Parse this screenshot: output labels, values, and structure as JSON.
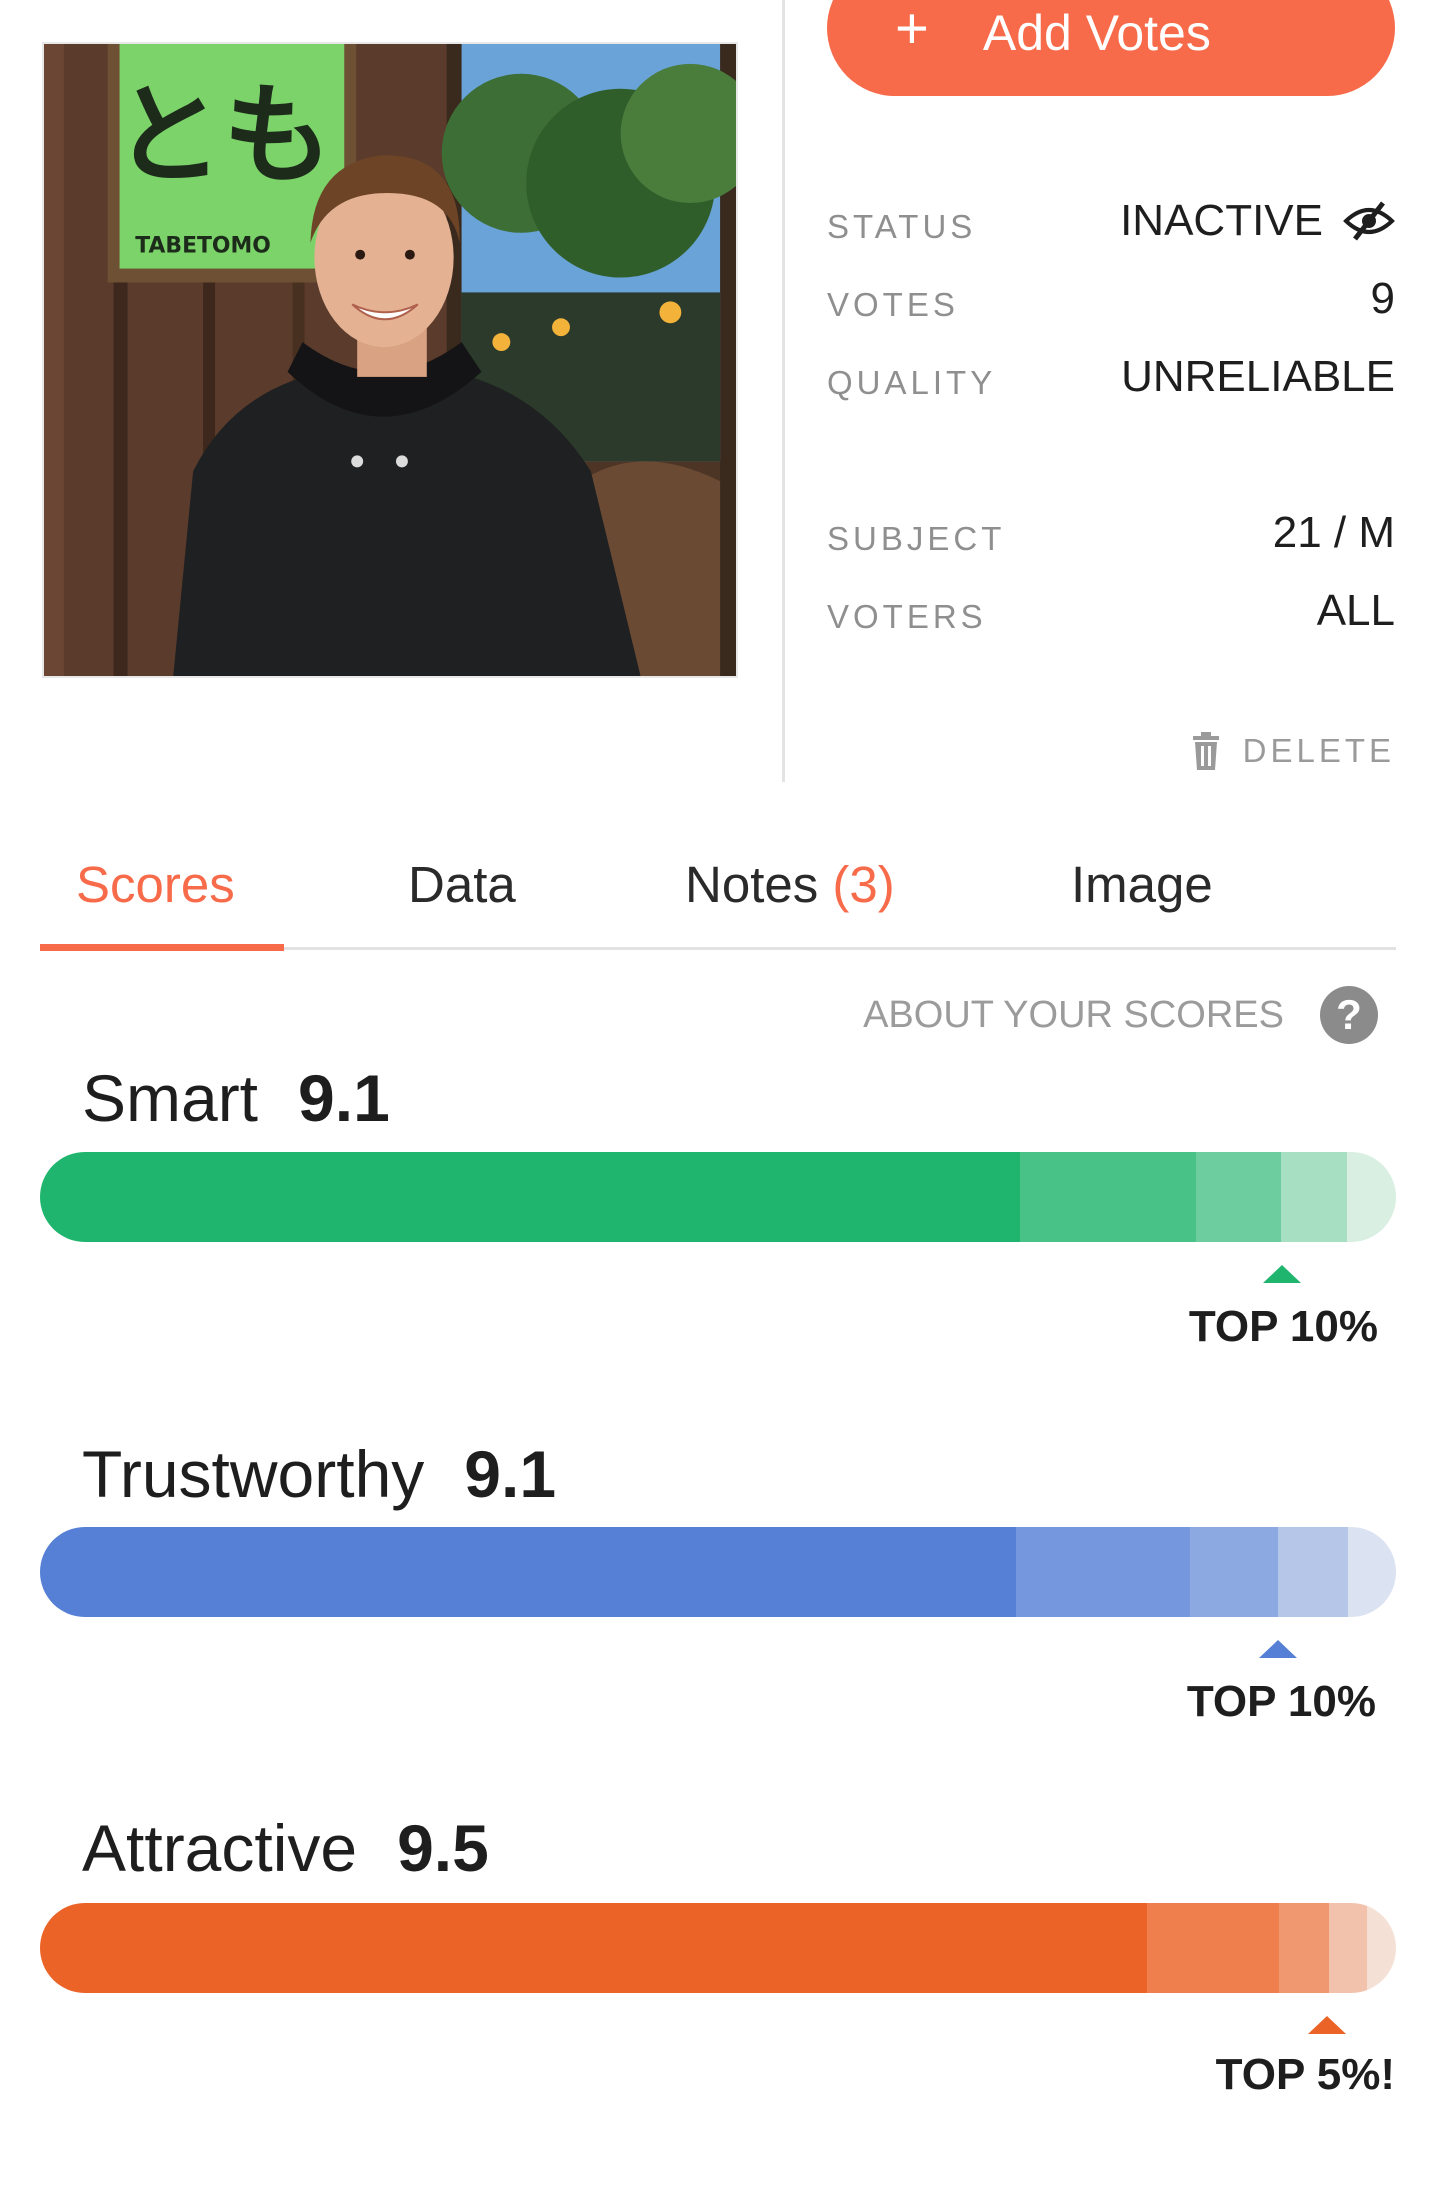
{
  "header": {
    "add_votes": {
      "icon": "plus-icon",
      "plus": "+",
      "label": "Add Votes"
    }
  },
  "info": {
    "status": {
      "label": "STATUS",
      "value": "INACTIVE",
      "icon": "eye-slash-icon"
    },
    "votes": {
      "label": "VOTES",
      "value": "9"
    },
    "quality": {
      "label": "QUALITY",
      "value": "UNRELIABLE"
    },
    "subject": {
      "label": "SUBJECT",
      "value": "21 / M"
    },
    "voters": {
      "label": "VOTERS",
      "value": "ALL"
    },
    "delete": {
      "label": "DELETE",
      "icon": "trash-icon"
    }
  },
  "photo": {
    "sign_text": "TABETOMO",
    "sign_glyph": "とも"
  },
  "tabs": [
    {
      "label": "Scores",
      "active": true
    },
    {
      "label": "Data"
    },
    {
      "label": "Notes",
      "count": "(3)"
    },
    {
      "label": "Image"
    }
  ],
  "about": {
    "label": "ABOUT YOUR SCORES",
    "icon": "help-icon",
    "glyph": "?"
  },
  "scores": [
    {
      "label": "Smart",
      "value": "9.1",
      "rank": "TOP 10%",
      "color": "#20b56e"
    },
    {
      "label": "Trustworthy",
      "value": "9.1",
      "rank": "TOP 10%",
      "color": "#5580d6"
    },
    {
      "label": "Attractive",
      "value": "9.5",
      "rank": "TOP 5%!",
      "color": "#ec6328"
    }
  ],
  "colors": {
    "accent": "#f76b4a",
    "muted": "#8f8f8f"
  }
}
